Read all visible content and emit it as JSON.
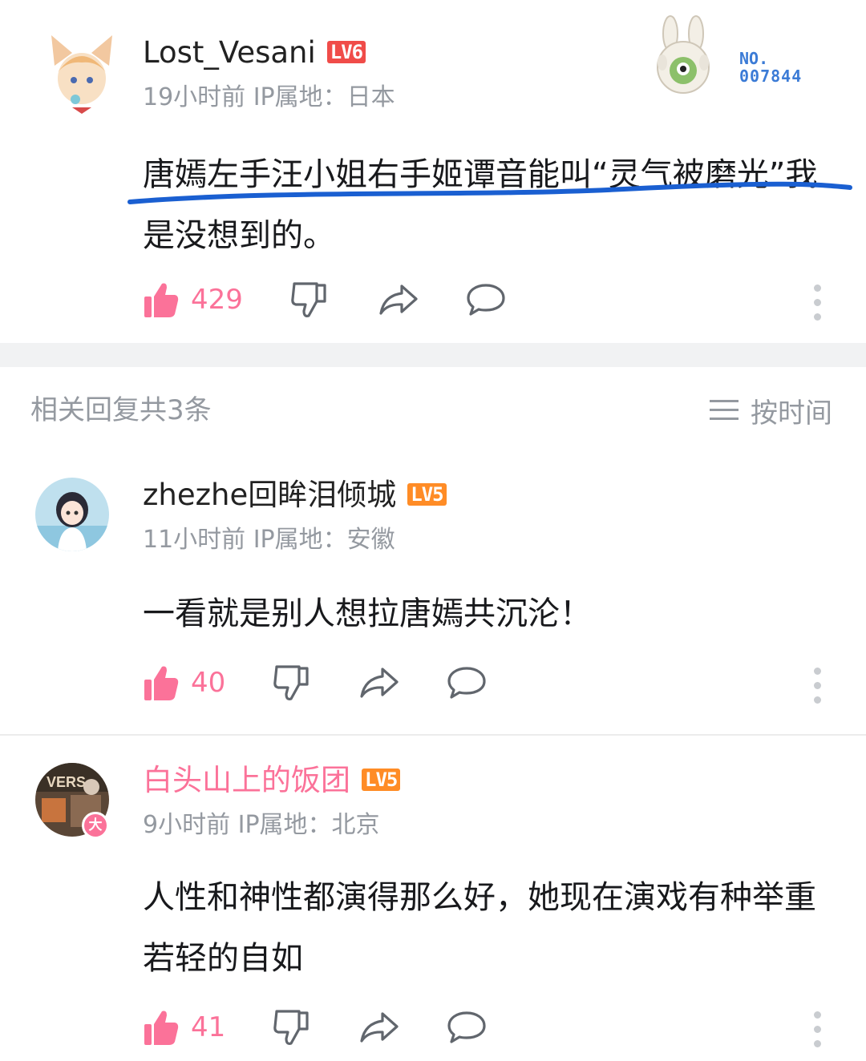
{
  "main_comment": {
    "username": "Lost_Vesani",
    "level": "LV6",
    "meta": "19小时前 IP属地：日本",
    "content": "唐嫣左手汪小姐右手姬谭音能叫“灵气被磨光”我是没想到的。",
    "likes": "429",
    "badge": {
      "no_label": "NO.",
      "number": "007844"
    }
  },
  "replies_header": {
    "count_label": "相关回复共3条",
    "sort_label": "按时间"
  },
  "replies": [
    {
      "username": "zhezhe回眸泪倾城",
      "level": "LV5",
      "meta": "11小时前 IP属地：安徽",
      "content": "一看就是别人想拉唐嫣共沉沦！",
      "likes": "40"
    },
    {
      "username": "白头山上的饭团",
      "level": "LV5",
      "meta": "9小时前 IP属地：北京",
      "content": "人性和神性都演得那么好，她现在演戏有种举重若轻的自如",
      "likes": "41",
      "avatar_badge": "大"
    }
  ],
  "colors": {
    "like_pink": "#fb7299",
    "lv6": "#f04c49",
    "lv5": "#ff8c26",
    "highlight_underline": "#1a5fd1",
    "badge_blue": "#3b7bd6",
    "meta_gray": "#9499a0"
  },
  "icons": [
    "thumbs-up-icon",
    "thumbs-down-icon",
    "share-icon",
    "comment-icon",
    "more-vertical-icon",
    "sort-lines-icon"
  ]
}
